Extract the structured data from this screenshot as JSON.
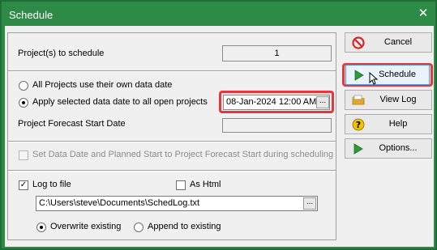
{
  "window": {
    "title": "Schedule",
    "close_glyph": "✕"
  },
  "main": {
    "projects_label": "Project(s) to schedule",
    "projects_count": "1",
    "radio_own_label": "All Projects use their own data date",
    "radio_apply_label": "Apply selected data date to all open projects",
    "data_date_value": "08-Jan-2024 12:00 AM",
    "dots": "...",
    "forecast_label": "Project Forecast Start Date",
    "forecast_value": "",
    "set_data_date_label": "Set Data Date and Planned Start to Project Forecast Start during scheduling",
    "log_to_file_label": "Log to file",
    "as_html_label": "As Html",
    "log_path": "C:\\Users\\steve\\Documents\\SchedLog.txt",
    "overwrite_label": "Overwrite existing",
    "append_label": "Append to existing",
    "check_glyph": "✓"
  },
  "buttons": {
    "cancel": "Cancel",
    "schedule": "Schedule",
    "view_log": "View Log",
    "help": "Help",
    "options": "Options..."
  },
  "colors": {
    "titlebar": "#2e8b47",
    "highlight": "#e5383b",
    "play_green": "#2e9b3a",
    "cancel_red": "#d62828",
    "help_yellow": "#f2c200"
  },
  "icons": [
    "close-icon",
    "cancel-icon",
    "play-icon",
    "folder-icon",
    "help-icon",
    "cursor-icon",
    "ellipsis-icon"
  ]
}
